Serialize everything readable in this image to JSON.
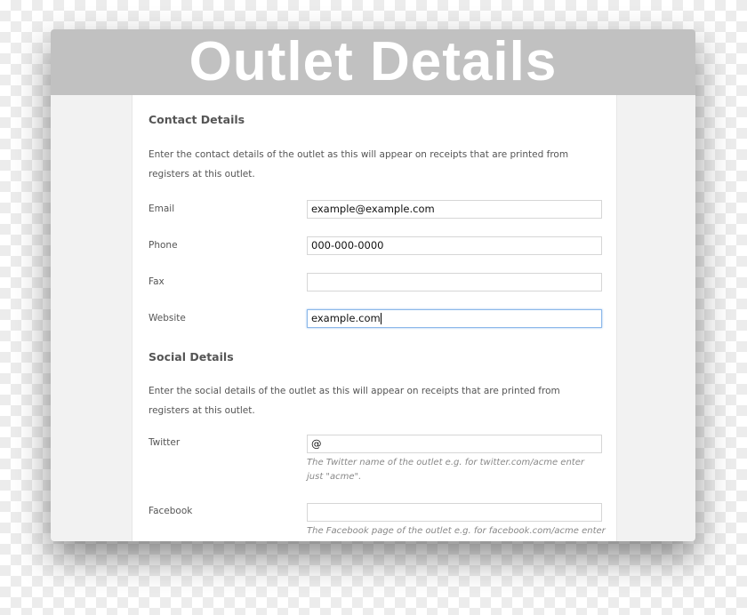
{
  "window": {
    "title": "Outlet Details"
  },
  "contact": {
    "heading": "Contact Details",
    "description": "Enter the contact details of the outlet as this will appear on receipts that are printed from registers at this outlet.",
    "fields": [
      {
        "label": "Email",
        "value": "example@example.com"
      },
      {
        "label": "Phone",
        "value": "000-000-0000"
      },
      {
        "label": "Fax",
        "value": ""
      },
      {
        "label": "Website",
        "value": "example.com"
      }
    ]
  },
  "social": {
    "heading": "Social Details",
    "description": "Enter the social details of the outlet as this will appear on receipts that are printed from registers at this outlet.",
    "fields": [
      {
        "label": "Twitter",
        "value": "@",
        "hint": "The Twitter name of the outlet e.g. for twitter.com/acme enter just \"acme\"."
      },
      {
        "label": "Facebook",
        "value": "",
        "hint": "The Facebook page of the outlet e.g. for facebook.com/acme enter"
      }
    ]
  },
  "colors": {
    "header": "#c1c1c1",
    "focus": "#8cb8ea"
  }
}
